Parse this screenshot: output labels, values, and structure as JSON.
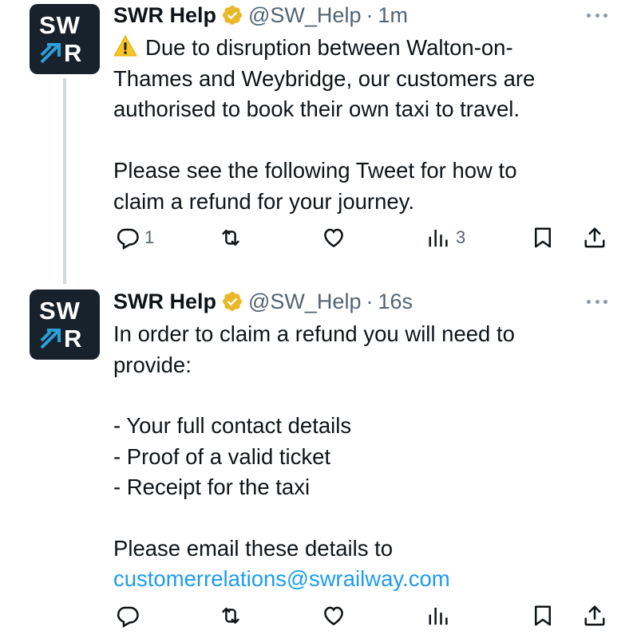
{
  "tweets": [
    {
      "avatar": {
        "line1": "SW",
        "line2": "R"
      },
      "name": "SWR Help",
      "handle": "@SW_Help",
      "separator": "·",
      "time": "1m",
      "text_para1": "Due to disruption between Walton-on-\nThames and Weybridge, our customers are\nauthorised to book their own taxi to travel.",
      "text_para2": "Please see the following Tweet for how to\nclaim a refund for your journey.",
      "reply_count": "1",
      "views_count": "3"
    },
    {
      "avatar": {
        "line1": "SW",
        "line2": "R"
      },
      "name": "SWR Help",
      "handle": "@SW_Help",
      "separator": "·",
      "time": "16s",
      "text_para1": "In order to claim a refund you will need to\nprovide:",
      "text_list": "- Your full contact details\n- Proof of a valid ticket\n- Receipt for the taxi",
      "text_para3": "Please email these details to",
      "email": "customerrelations@swrailway.com"
    }
  ],
  "colors": {
    "link": "#1d9bf0",
    "verified": "#e8b829",
    "muted": "#536471",
    "avatar_bg": "#18222d"
  }
}
